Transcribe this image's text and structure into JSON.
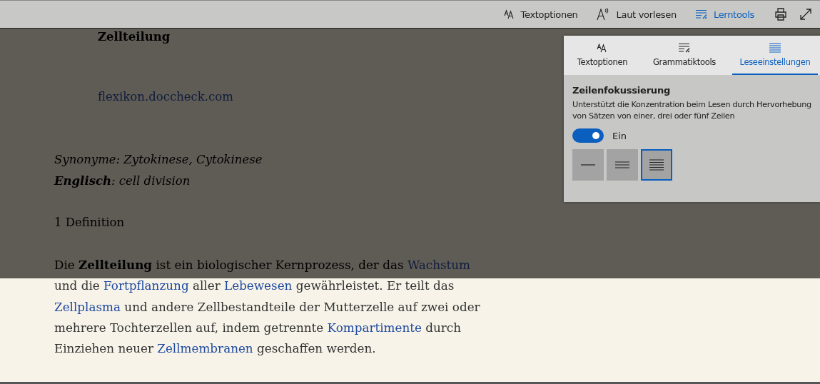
{
  "toolbar": {
    "items": [
      {
        "label": "Textoptionen",
        "selected": false
      },
      {
        "label": "Laut vorlesen",
        "selected": false
      },
      {
        "label": "Lerntools",
        "selected": true
      }
    ]
  },
  "article": {
    "heading": "Zellteilung",
    "source_link": "flexikon.doccheck.com",
    "synonyms": "Synonyme: Zytokinese, Cytokinese",
    "english": "**Englisch**: cell division",
    "section": "1 Definition",
    "paragraph": [
      {
        "kind": "text",
        "text": "Die "
      },
      {
        "kind": "bold",
        "text": "Zellteilung"
      },
      {
        "kind": "text",
        "text": " ist ein biologischer Kernprozess, der das "
      },
      {
        "kind": "link",
        "text": "Wachstum"
      },
      {
        "kind": "text",
        "text": " und die "
      },
      {
        "kind": "link",
        "text": "Fortpflanzung"
      },
      {
        "kind": "text",
        "text": " aller "
      },
      {
        "kind": "link",
        "text": "Lebewesen"
      },
      {
        "kind": "text",
        "text": " gewährleistet. Er teilt das "
      },
      {
        "kind": "link",
        "text": "Zellplasma"
      },
      {
        "kind": "text",
        "text": " und andere Zellbestandteile der Mutterzelle auf zwei oder mehrere Tochterzellen auf, indem getrennte "
      },
      {
        "kind": "link",
        "text": "Kompartimente"
      },
      {
        "kind": "text",
        "text": " durch Einziehen neuer "
      },
      {
        "kind": "link",
        "text": "Zellmembranen"
      },
      {
        "kind": "text",
        "text": " geschaffen werden."
      }
    ]
  },
  "panel": {
    "tabs": [
      {
        "label": "Textoptionen",
        "selected": false
      },
      {
        "label": "Grammatiktools",
        "selected": false
      },
      {
        "label": "Leseeinstellungen",
        "selected": true
      }
    ],
    "title": "Zeilenfokussierung",
    "description": "Unterstützt die Konzentration beim Lesen durch Hervorhebung von Sätzen von einer, drei oder fünf Zeilen",
    "toggle": {
      "on": true,
      "label": "Ein"
    },
    "line_options": [
      {
        "kind": "one",
        "selected": false
      },
      {
        "kind": "three",
        "selected": false
      },
      {
        "kind": "five",
        "selected": true
      }
    ]
  }
}
